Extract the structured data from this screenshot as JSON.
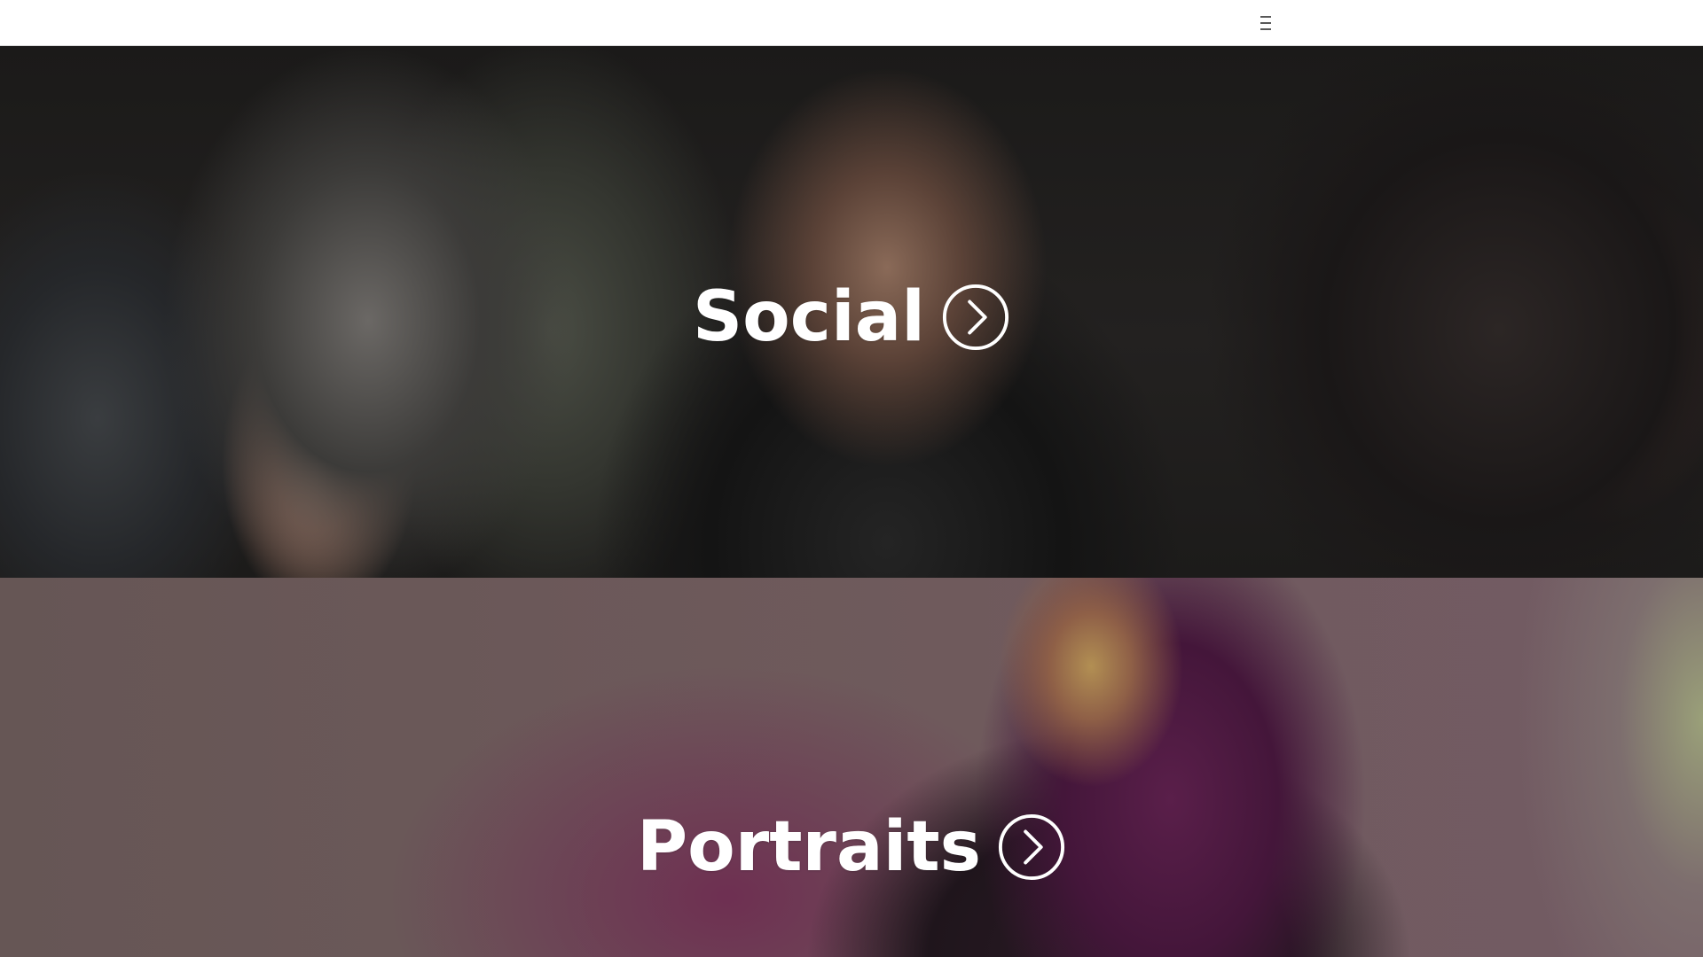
{
  "header": {
    "menu_icon": "hamburger-menu-icon"
  },
  "sections": [
    {
      "label": "Social",
      "icon": "chevron-right-circle-icon"
    },
    {
      "label": "Portraits",
      "icon": "chevron-right-circle-icon"
    }
  ],
  "colors": {
    "header_background": "#ffffff",
    "label_text": "#ffffff",
    "icon_stroke": "#ffffff"
  }
}
